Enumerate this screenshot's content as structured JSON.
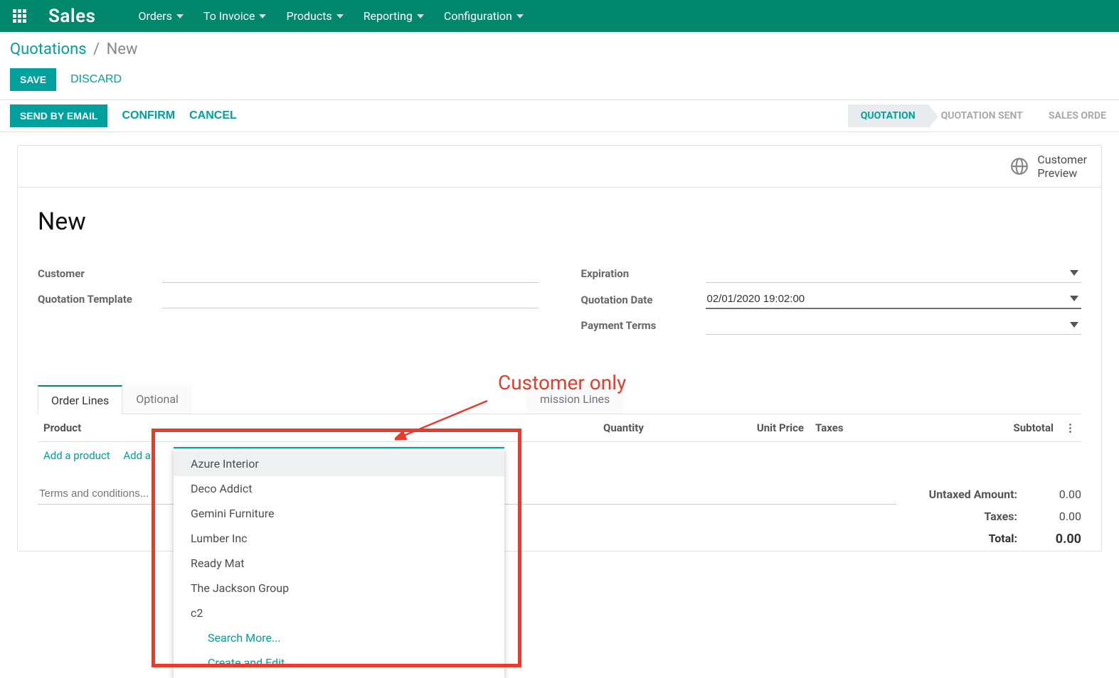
{
  "navbar": {
    "brand": "Sales",
    "menus": [
      "Orders",
      "To Invoice",
      "Products",
      "Reporting",
      "Configuration"
    ]
  },
  "breadcrumb": {
    "parent": "Quotations",
    "current": "New"
  },
  "header_buttons": {
    "save": "SAVE",
    "discard": "DISCARD"
  },
  "statusbar": {
    "left": {
      "send": "SEND BY EMAIL",
      "confirm": "CONFIRM",
      "cancel": "CANCEL"
    },
    "steps": [
      "QUOTATION",
      "QUOTATION SENT",
      "SALES ORDE"
    ],
    "active_index": 0
  },
  "preview": {
    "line1": "Customer",
    "line2": "Preview"
  },
  "record_title": "New",
  "fields": {
    "customer": {
      "label": "Customer",
      "value": ""
    },
    "quotation_template": {
      "label": "Quotation Template",
      "value": ""
    },
    "expiration": {
      "label": "Expiration",
      "value": ""
    },
    "quotation_date": {
      "label": "Quotation Date",
      "value": "02/01/2020 19:02:00"
    },
    "payment_terms": {
      "label": "Payment Terms",
      "value": ""
    }
  },
  "dropdown": {
    "options": [
      "Azure Interior",
      "Deco Addict",
      "Gemini Furniture",
      "Lumber Inc",
      "Ready Mat",
      "The Jackson Group",
      "c2"
    ],
    "search_more": "Search More...",
    "create_edit": "Create and Edit..."
  },
  "annotation": "Customer only",
  "tabs": {
    "labels": [
      "Order Lines",
      "Optional",
      "mission Lines"
    ],
    "active_index": 0
  },
  "table": {
    "columns": {
      "product": "Product",
      "quantity": "Quantity",
      "unit_price": "Unit Price",
      "taxes": "Taxes",
      "subtotal": "Subtotal"
    },
    "add_product": "Add a product",
    "add_alt": "Add a"
  },
  "footer": {
    "terms_placeholder": "Terms and conditions...",
    "untaxed_label": "Untaxed Amount:",
    "untaxed_amount": "0.00",
    "taxes_label": "Taxes:",
    "taxes_amount": "0.00",
    "total_label": "Total:",
    "total_amount": "0.00"
  }
}
